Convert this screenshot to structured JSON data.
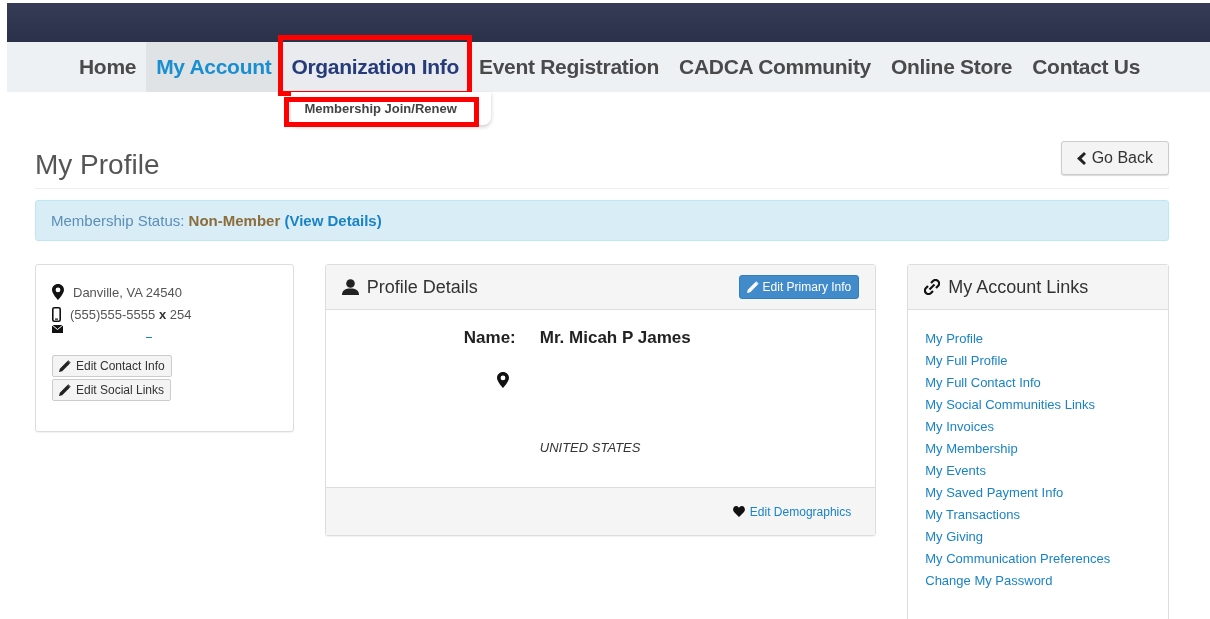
{
  "nav": {
    "items": [
      {
        "label": "Home",
        "selected": false,
        "expanded": false,
        "highlighted": false
      },
      {
        "label": "My Account",
        "selected": true,
        "expanded": false,
        "highlighted": false
      },
      {
        "label": "Organization Info",
        "selected": false,
        "expanded": true,
        "highlighted": true,
        "menu": [
          {
            "label": "Membership Join/Renew",
            "highlighted": true
          }
        ]
      },
      {
        "label": "Event Registration",
        "selected": false,
        "expanded": false,
        "highlighted": false
      },
      {
        "label": "CADCA Community",
        "selected": false,
        "expanded": false,
        "highlighted": false
      },
      {
        "label": "Online Store",
        "selected": false,
        "expanded": false,
        "highlighted": false
      },
      {
        "label": "Contact Us",
        "selected": false,
        "expanded": false,
        "highlighted": false
      }
    ]
  },
  "page_title": "My Profile",
  "go_back": "Go Back",
  "membership": {
    "label": "Membership Status:",
    "status": "Non-Member",
    "open": "(",
    "link": "View Details",
    "close": ")"
  },
  "contact_card": {
    "location": "Danville, VA 24540",
    "phone": "(555)555-5555",
    "ext_label": "x",
    "ext": "254",
    "buttons": [
      "Edit Contact Info",
      "Edit Social Links"
    ]
  },
  "profile_details": {
    "title": "Profile Details",
    "edit_button": "Edit Primary Info",
    "name_label": "Name:",
    "name": "Mr. Micah P James",
    "country": "UNITED STATES",
    "footer_link": "Edit Demographics"
  },
  "account_links": {
    "title": "My Account Links",
    "links": [
      "My Profile",
      "My Full Profile",
      "My Full Contact Info",
      "My Social Communities Links",
      "My Invoices",
      "My Membership",
      "My Events",
      "My Saved Payment Info",
      "My Transactions",
      "My Giving",
      "My Communication Preferences",
      "Change My Password"
    ]
  }
}
